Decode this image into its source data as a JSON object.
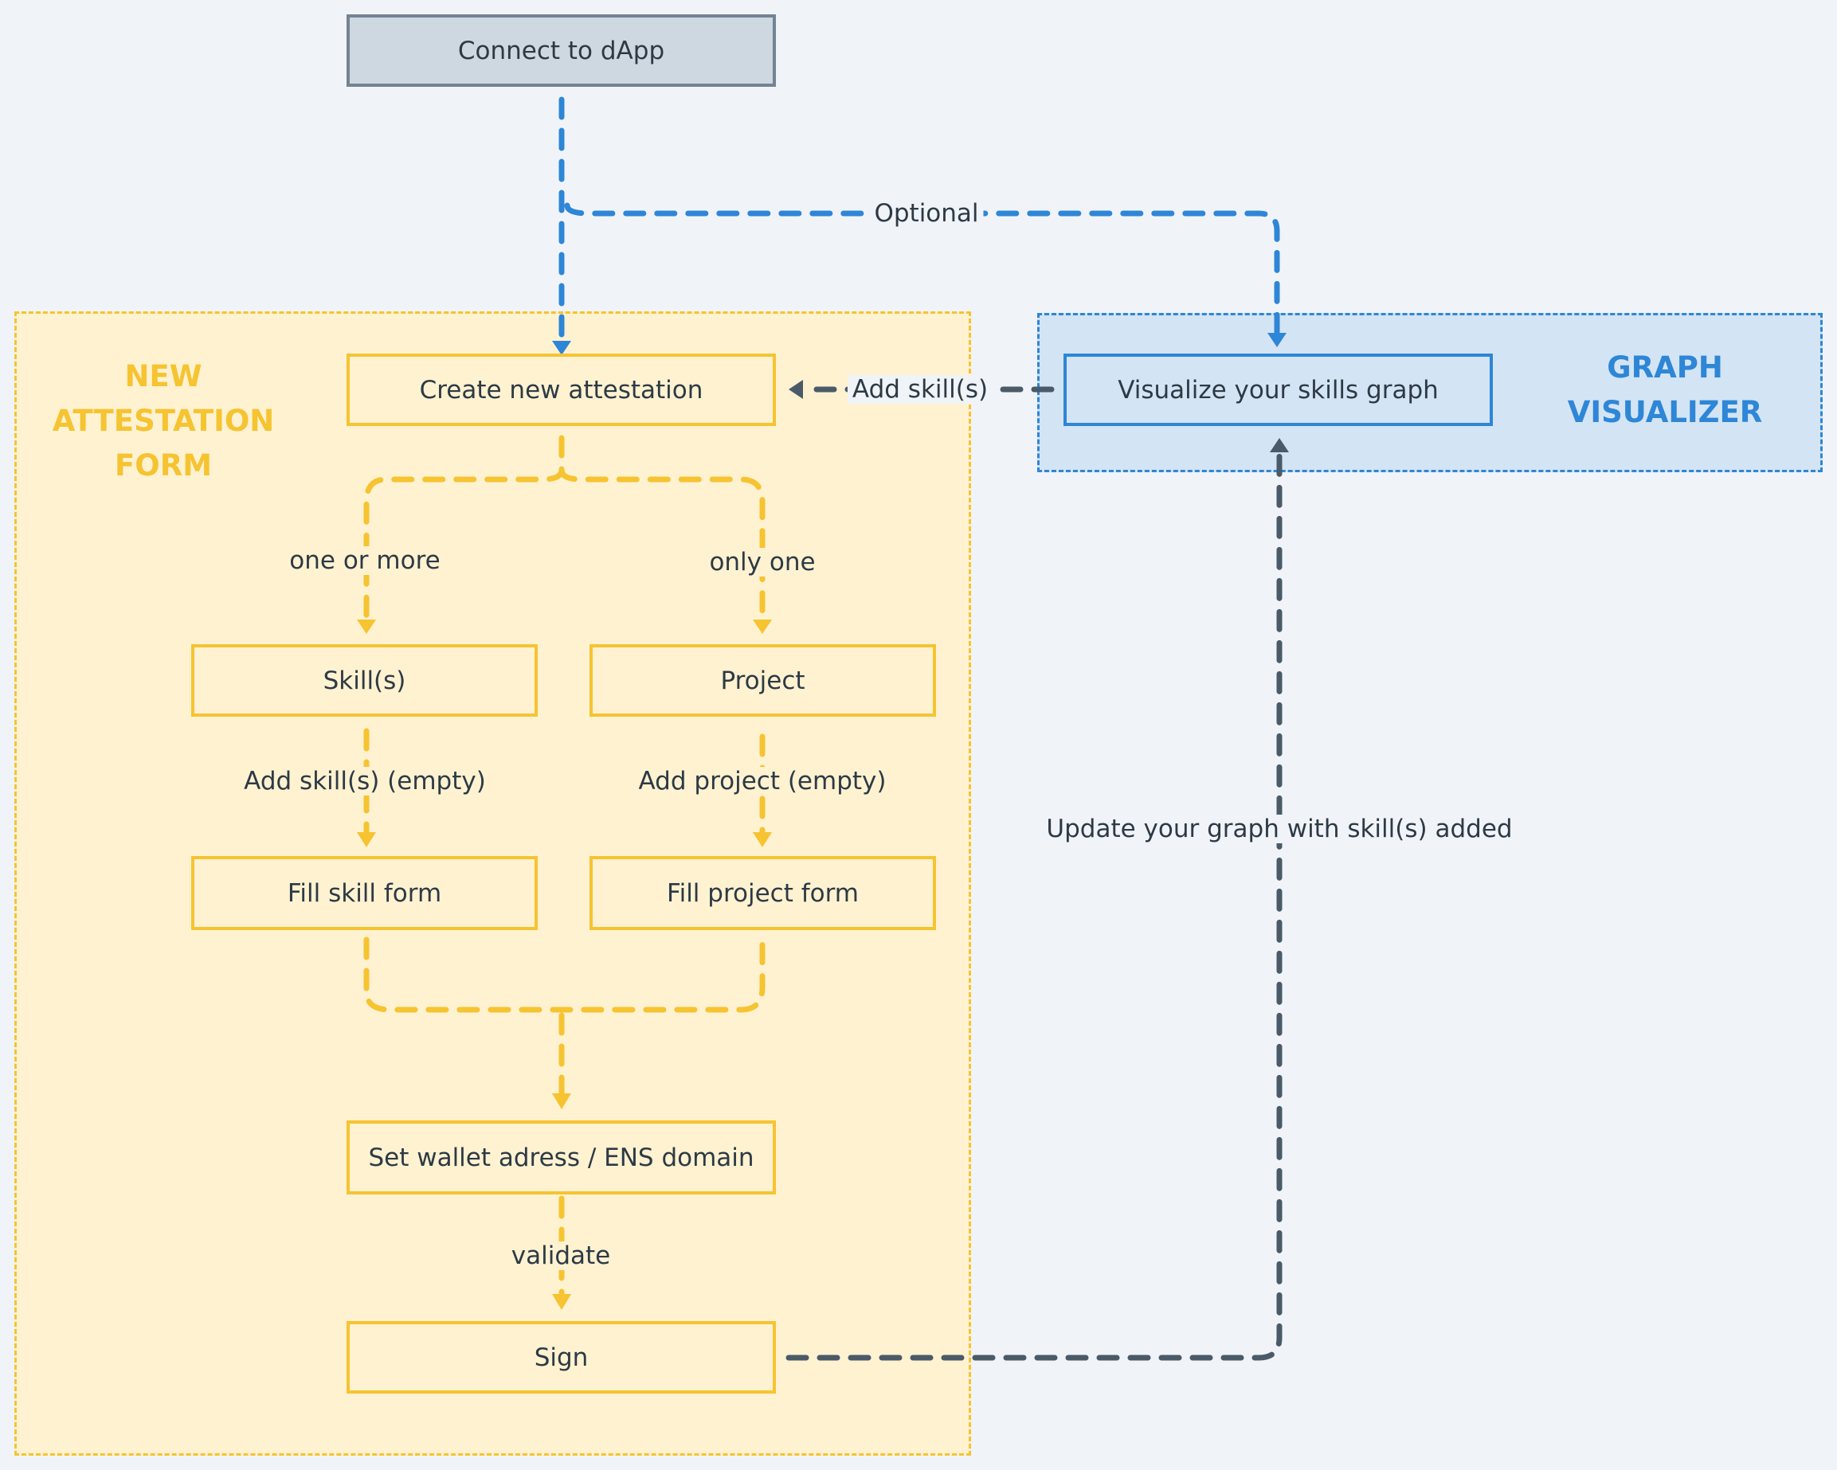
{
  "colors": {
    "background": "#f0f4f8",
    "yellow": "#f6c331",
    "yellow_fill": "#fff2d1",
    "blue": "#2e86d6",
    "blue_fill": "#d3e4f4",
    "dark": "#4a5a68",
    "gray_fill": "#cdd8e0",
    "gray_border": "#738393",
    "text": "#2d3a45"
  },
  "groups": {
    "attestation": {
      "title": "NEW\nATTESTATION\nFORM"
    },
    "visualizer": {
      "title": "GRAPH\nVISUALIZER"
    }
  },
  "nodes": {
    "connect": "Connect to dApp",
    "create": "Create new attestation",
    "visualize": "Visualize your skills graph",
    "skills": "Skill(s)",
    "project": "Project",
    "fill_skill": "Fill skill form",
    "fill_project": "Fill project form",
    "wallet": "Set wallet adress / ENS domain",
    "sign": "Sign"
  },
  "edges": {
    "optional": "Optional",
    "add_skills": "Add skill(s)",
    "one_or_more": "one or more",
    "only_one": "only one",
    "add_skill_empty": "Add skill(s) (empty)",
    "add_project_empty": "Add project (empty)",
    "validate": "validate",
    "update_graph": "Update your graph with skill(s) added"
  }
}
